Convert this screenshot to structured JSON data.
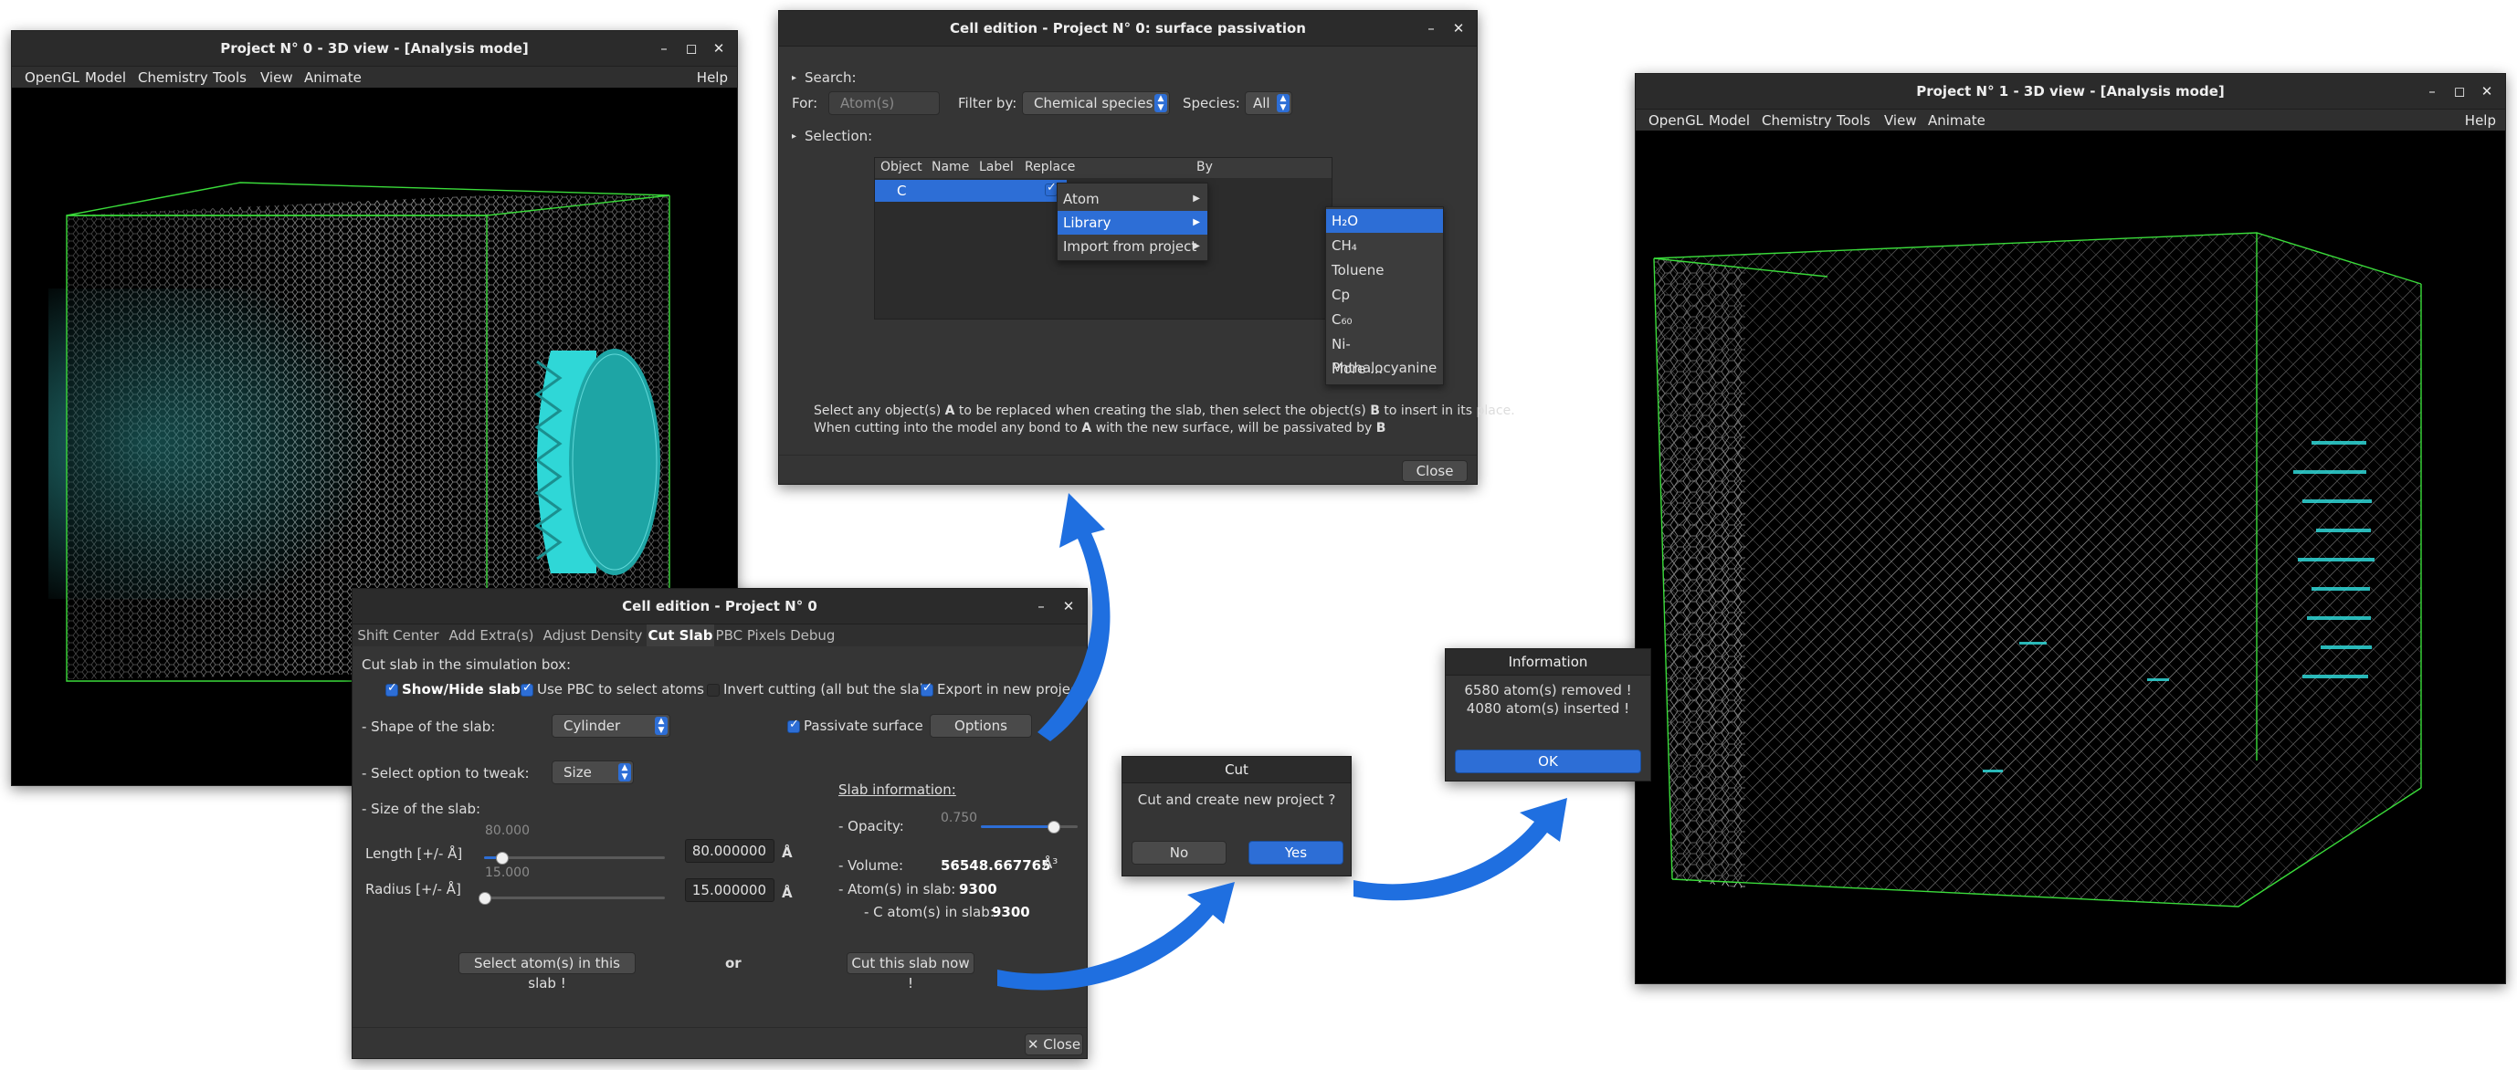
{
  "colors": {
    "accent": "#2d6ed6",
    "window_bg": "#353535",
    "cell_green": "#3adb3a",
    "atom_cyan": "#2fd7d7",
    "arrow_blue": "#1f6fe0"
  },
  "window_controls": {
    "minimize": "–",
    "maximize": "◻",
    "close": "✕"
  },
  "view_menu": [
    "OpenGL",
    "Model",
    "Chemistry",
    "Tools",
    "View",
    "Animate"
  ],
  "view_help": "Help",
  "project0_view": {
    "title": "Project N° 0 - 3D view - [Analysis mode]"
  },
  "project1_view": {
    "title": "Project N° 1 - 3D view - [Analysis mode]"
  },
  "passivation": {
    "title": "Cell edition - Project N° 0: surface passivation",
    "search_label": "Search:",
    "for_label": "For:",
    "for_value": "Atom(s)",
    "filter_label": "Filter by:",
    "filter_value": "Chemical species",
    "species_label": "Species:",
    "species_value": "All",
    "selection_label": "Selection:",
    "columns": [
      "Object",
      "Name",
      "Label",
      "Replace",
      "By"
    ],
    "row": {
      "object": "C"
    },
    "menu": [
      "Atom",
      "Library",
      "Import from project"
    ],
    "library_items": [
      "H₂O",
      "CH₄",
      "Toluene",
      "Cp",
      "C₆₀",
      "Ni-Phthalocyanine",
      "More ..."
    ],
    "help_line1_a": "Select any object(s) ",
    "help_line1_b": "A",
    "help_line1_c": " to be replaced when creating the slab, then select the object(s) ",
    "help_line1_d": "B",
    "help_line1_e": " to insert in its place.",
    "help_line2_a": "When cutting into the model any bond to ",
    "help_line2_b": "A",
    "help_line2_c": " with the new surface, will be passivated by ",
    "help_line2_d": "B",
    "close": "Close"
  },
  "cell_edition": {
    "title": "Cell edition - Project N° 0",
    "tabs": [
      "Shift Center",
      "Add Extra(s)",
      "Adjust Density",
      "Cut Slab",
      "PBC Pixels Debug"
    ],
    "intro": "Cut slab in the simulation box:",
    "show_hide": "Show/Hide slab",
    "use_pbc": "Use PBC to select atoms",
    "invert": "Invert cutting (all but the slab)",
    "export": "Export in new project",
    "shape_label": "- Shape of the slab:",
    "shape_value": "Cylinder",
    "passivate": "Passivate surface",
    "options": "Options",
    "tweak_label": "- Select option to tweak:",
    "tweak_value": "Size",
    "slab_info": "Slab information:",
    "opacity_label": "- Opacity:",
    "opacity_value": "0.750",
    "size_label": "- Size of the slab:",
    "length_label": "Length [+/- Å]",
    "length_slider": "80.000",
    "length_value": "80.000000",
    "unit_a": "Å",
    "radius_label": "Radius [+/- Å]",
    "radius_slider": "15.000",
    "radius_value": "15.000000",
    "volume_label": "- Volume:",
    "volume_value": "56548.667765",
    "volume_unit": "Å³",
    "atoms_label": "- Atom(s) in slab:",
    "atoms_value": "9300",
    "c_atoms_label": "- C atom(s) in slab:",
    "c_atoms_value": "9300",
    "select_btn": "Select atom(s) in this slab !",
    "or": "or",
    "cut_btn": "Cut this slab now !",
    "close": "Close"
  },
  "cut_dialog": {
    "title": "Cut",
    "message": "Cut and create new project ?",
    "no": "No",
    "yes": "Yes"
  },
  "info_dialog": {
    "title": "Information",
    "line1": "6580 atom(s) removed !",
    "line2": "4080 atom(s) inserted !",
    "ok": "OK"
  }
}
